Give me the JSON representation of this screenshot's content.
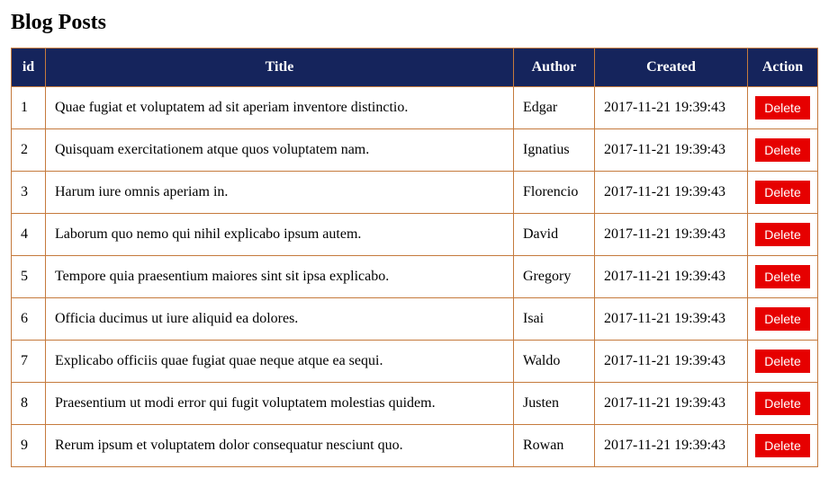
{
  "page_title": "Blog Posts",
  "columns": {
    "id": "id",
    "title": "Title",
    "author": "Author",
    "created": "Created",
    "action": "Action"
  },
  "action_label": "Delete",
  "rows": [
    {
      "id": "1",
      "title": "Quae fugiat et voluptatem ad sit aperiam inventore distinctio.",
      "author": "Edgar",
      "created": "2017-11-21 19:39:43"
    },
    {
      "id": "2",
      "title": "Quisquam exercitationem atque quos voluptatem nam.",
      "author": "Ignatius",
      "created": "2017-11-21 19:39:43"
    },
    {
      "id": "3",
      "title": "Harum iure omnis aperiam in.",
      "author": "Florencio",
      "created": "2017-11-21 19:39:43"
    },
    {
      "id": "4",
      "title": "Laborum quo nemo qui nihil explicabo ipsum autem.",
      "author": "David",
      "created": "2017-11-21 19:39:43"
    },
    {
      "id": "5",
      "title": "Tempore quia praesentium maiores sint sit ipsa explicabo.",
      "author": "Gregory",
      "created": "2017-11-21 19:39:43"
    },
    {
      "id": "6",
      "title": "Officia ducimus ut iure aliquid ea dolores.",
      "author": "Isai",
      "created": "2017-11-21 19:39:43"
    },
    {
      "id": "7",
      "title": "Explicabo officiis quae fugiat quae neque atque ea sequi.",
      "author": "Waldo",
      "created": "2017-11-21 19:39:43"
    },
    {
      "id": "8",
      "title": "Praesentium ut modi error qui fugit voluptatem molestias quidem.",
      "author": "Justen",
      "created": "2017-11-21 19:39:43"
    },
    {
      "id": "9",
      "title": "Rerum ipsum et voluptatem dolor consequatur nesciunt quo.",
      "author": "Rowan",
      "created": "2017-11-21 19:39:43"
    }
  ]
}
